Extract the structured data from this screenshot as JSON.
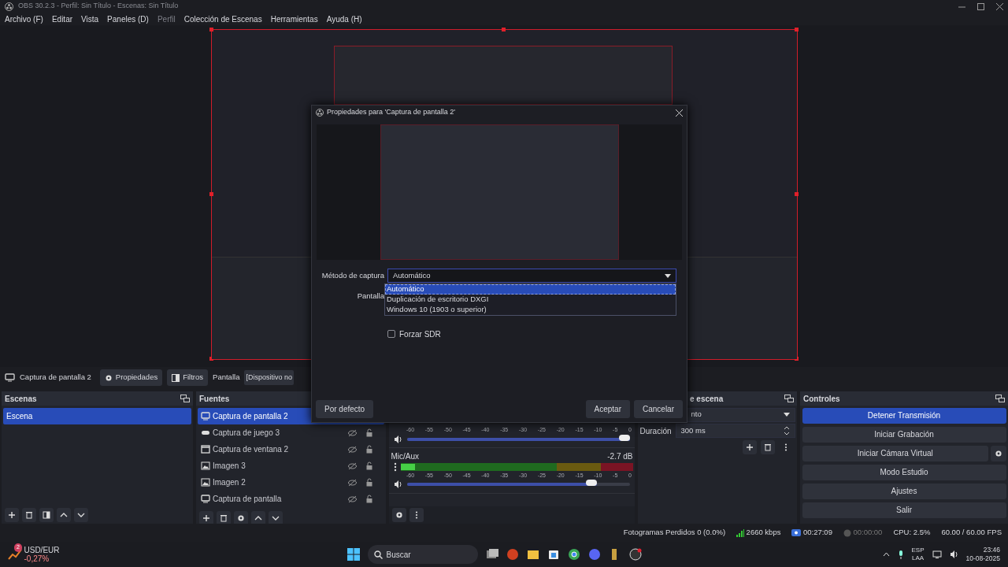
{
  "window": {
    "title": "OBS 30.2.3 - Perfil: Sin Título - Escenas: Sin Título"
  },
  "menu": [
    {
      "label": "Archivo (F)",
      "disabled": false
    },
    {
      "label": "Editar",
      "disabled": false
    },
    {
      "label": "Vista",
      "disabled": false
    },
    {
      "label": "Paneles (D)",
      "disabled": false
    },
    {
      "label": "Perfil",
      "disabled": true
    },
    {
      "label": "Colección de Escenas",
      "disabled": false
    },
    {
      "label": "Herramientas",
      "disabled": false
    },
    {
      "label": "Ayuda (H)",
      "disabled": false
    }
  ],
  "source_toolbar": {
    "source_name": "Captura de pantalla 2",
    "buttons": [
      {
        "label": "Propiedades",
        "kind": "gear"
      },
      {
        "label": "Filtros",
        "kind": "filter"
      }
    ],
    "property_label": "Pantalla",
    "property_value": "[Dispositivo no"
  },
  "scenes": {
    "title": "Escenas",
    "items": [
      {
        "label": "Escena",
        "selected": true
      }
    ]
  },
  "sources": {
    "title": "Fuentes",
    "items": [
      {
        "label": "Captura de pantalla 2",
        "kind": "display",
        "selected": true
      },
      {
        "label": "Captura de juego 3",
        "kind": "game",
        "selected": false
      },
      {
        "label": "Captura de ventana 2",
        "kind": "window",
        "selected": false
      },
      {
        "label": "Imagen 3",
        "kind": "image",
        "selected": false
      },
      {
        "label": "Imagen 2",
        "kind": "image",
        "selected": false
      },
      {
        "label": "Captura de pantalla",
        "kind": "display",
        "selected": false
      }
    ]
  },
  "mixer": {
    "channels": [
      {
        "scale": [
          "-60",
          "-55",
          "-50",
          "-45",
          "-40",
          "-35",
          "-30",
          "-25",
          "-20",
          "-15",
          "-10",
          "-5",
          "0"
        ],
        "volume": {
          "level": 1.0
        }
      },
      {
        "name": "Mic/Aux",
        "reading": "-2.7 dB",
        "meter": {
          "level": 0.06
        },
        "scale": [
          "-60",
          "-55",
          "-50",
          "-45",
          "-40",
          "-35",
          "-30",
          "-25",
          "-20",
          "-15",
          "-10",
          "-5",
          "0"
        ],
        "volume": {
          "level": 0.85
        }
      }
    ]
  },
  "transitions": {
    "title": "e escena",
    "dropdown": "nto",
    "duration_label": "Duración",
    "duration": "300 ms"
  },
  "controls": {
    "title": "Controles",
    "buttons": [
      {
        "label": "Detener Transmisión",
        "active": true,
        "has_settings": false
      },
      {
        "label": "Iniciar Grabación",
        "active": false,
        "has_settings": false
      },
      {
        "label": "Iniciar Cámara Virtual",
        "active": false,
        "has_settings": true
      },
      {
        "label": "Modo Estudio",
        "active": false,
        "has_settings": false
      },
      {
        "label": "Ajustes",
        "active": false,
        "has_settings": false
      },
      {
        "label": "Salir",
        "active": false,
        "has_settings": false
      }
    ]
  },
  "status_bar": [
    {
      "kind": "text",
      "text": "Fotogramas Perdidos 0 (0.0%)"
    },
    {
      "kind": "bitrate",
      "text": "2660 kbps"
    },
    {
      "kind": "stream",
      "text": "00:27:09"
    },
    {
      "kind": "record",
      "text": "00:00:00"
    },
    {
      "kind": "text",
      "text": "CPU: 2.5%"
    },
    {
      "kind": "text",
      "text": "60.00 / 60.00 FPS"
    }
  ],
  "dialog": {
    "title": "Propiedades para 'Captura de pantalla 2'",
    "method_label": "Método de captura",
    "method_value": "Automático",
    "options": [
      {
        "label": "Automático",
        "selected": true
      },
      {
        "label": "Duplicación de escritorio DXGI",
        "selected": false
      },
      {
        "label": "Windows 10 (1903 o superior)",
        "selected": false
      }
    ],
    "display_label": "Pantalla",
    "checkbox": {
      "label": "Forzar SDR",
      "checked": false
    },
    "buttons": [
      {
        "label": "Por defecto",
        "kind": "left"
      },
      {
        "label": "Aceptar",
        "kind": "right"
      },
      {
        "label": "Cancelar",
        "kind": "right"
      }
    ]
  },
  "taskbar": {
    "widget_badge": "2",
    "widget_title": "USD/EUR",
    "widget_value": "-0,27%",
    "search": "Buscar",
    "language": "ESP",
    "layout": "LAA",
    "time": "23:46",
    "date": "10-08-2025"
  }
}
